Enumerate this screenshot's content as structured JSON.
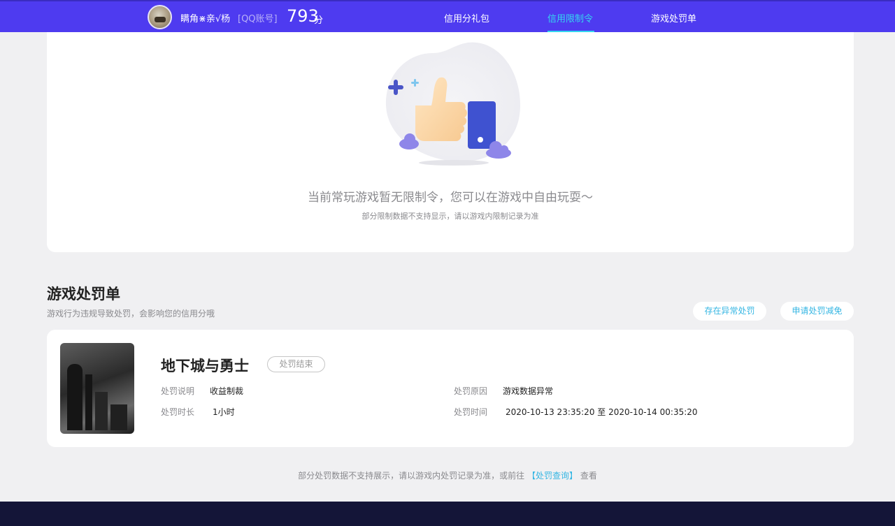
{
  "header": {
    "username": "瞒角⋇亲√杨",
    "account_type": "[QQ账号]",
    "score": "793",
    "score_unit": "分",
    "nav": [
      {
        "label": "信用分礼包",
        "active": false
      },
      {
        "label": "信用限制令",
        "active": true
      },
      {
        "label": "游戏处罚单",
        "active": false
      }
    ]
  },
  "restriction": {
    "empty_title": "当前常玩游戏暂无限制令，您可以在游戏中自由玩耍～",
    "empty_sub": "部分限制数据不支持显示，请以游戏内限制记录为准"
  },
  "punishment_section": {
    "title": "游戏处罚单",
    "subtitle": "游戏行为违规导致处罚，会影响您的信用分哦",
    "btn_appeal": "存在异常处罚",
    "btn_reduce": "申请处罚减免"
  },
  "punishment": {
    "game_name": "地下城与勇士",
    "status": "处罚结束",
    "desc_label": "处罚说明",
    "desc_value": "收益制裁",
    "duration_label": "处罚时长",
    "duration_value": "1小时",
    "reason_label": "处罚原因",
    "reason_value": "游戏数据异常",
    "time_label": "处罚时间",
    "time_value": "2020-10-13 23:35:20 至 2020-10-14 00:35:20"
  },
  "footer": {
    "note_prefix": "部分处罚数据不支持展示，请以游戏内处罚记录为准，或前往",
    "note_link": "【处罚查询】",
    "note_suffix": "查看"
  },
  "colors": {
    "nav_bg": "#4e3bf0",
    "nav_active": "#35d6f0",
    "link": "#35b6e3",
    "bottom_bar": "#141538"
  }
}
